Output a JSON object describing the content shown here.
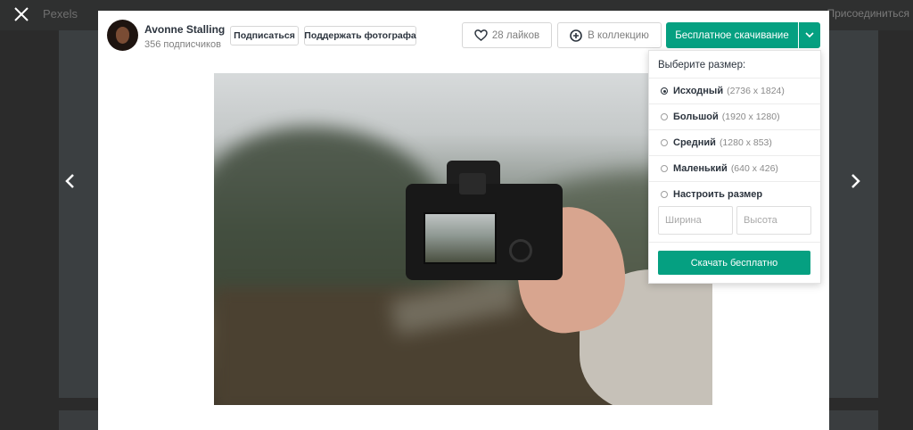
{
  "background": {
    "site_logo": "Pexels",
    "join_link": "Присоединиться"
  },
  "author": {
    "name": "Avonne Stalling",
    "subscribers": "356 подписчиков"
  },
  "actions": {
    "subscribe_label": "Подписаться",
    "donate_label": "Поддержать фотографа",
    "like_label": "28 лайков",
    "collection_label": "В коллекцию",
    "download_label": "Бесплатное скачивание"
  },
  "size_menu": {
    "title": "Выберите размер:",
    "options": [
      {
        "name": "Исходный",
        "dims": "(2736 x 1824)",
        "selected": true
      },
      {
        "name": "Большой",
        "dims": "(1920 x 1280)",
        "selected": false
      },
      {
        "name": "Средний",
        "dims": "(1280 x 853)",
        "selected": false
      },
      {
        "name": "Маленький",
        "dims": "(640 x 426)",
        "selected": false
      },
      {
        "name": "Настроить размер",
        "dims": "",
        "selected": false
      }
    ],
    "width_placeholder": "Ширина",
    "height_placeholder": "Высота",
    "submit_label": "Скачать бесплатно"
  },
  "colors": {
    "accent": "#05a081",
    "text": "#2c343e",
    "muted": "#7f7f7f"
  },
  "icons": [
    "close-icon",
    "heart-icon",
    "plus-circle-icon",
    "chevron-down-icon",
    "chevron-left-icon",
    "chevron-right-icon"
  ]
}
